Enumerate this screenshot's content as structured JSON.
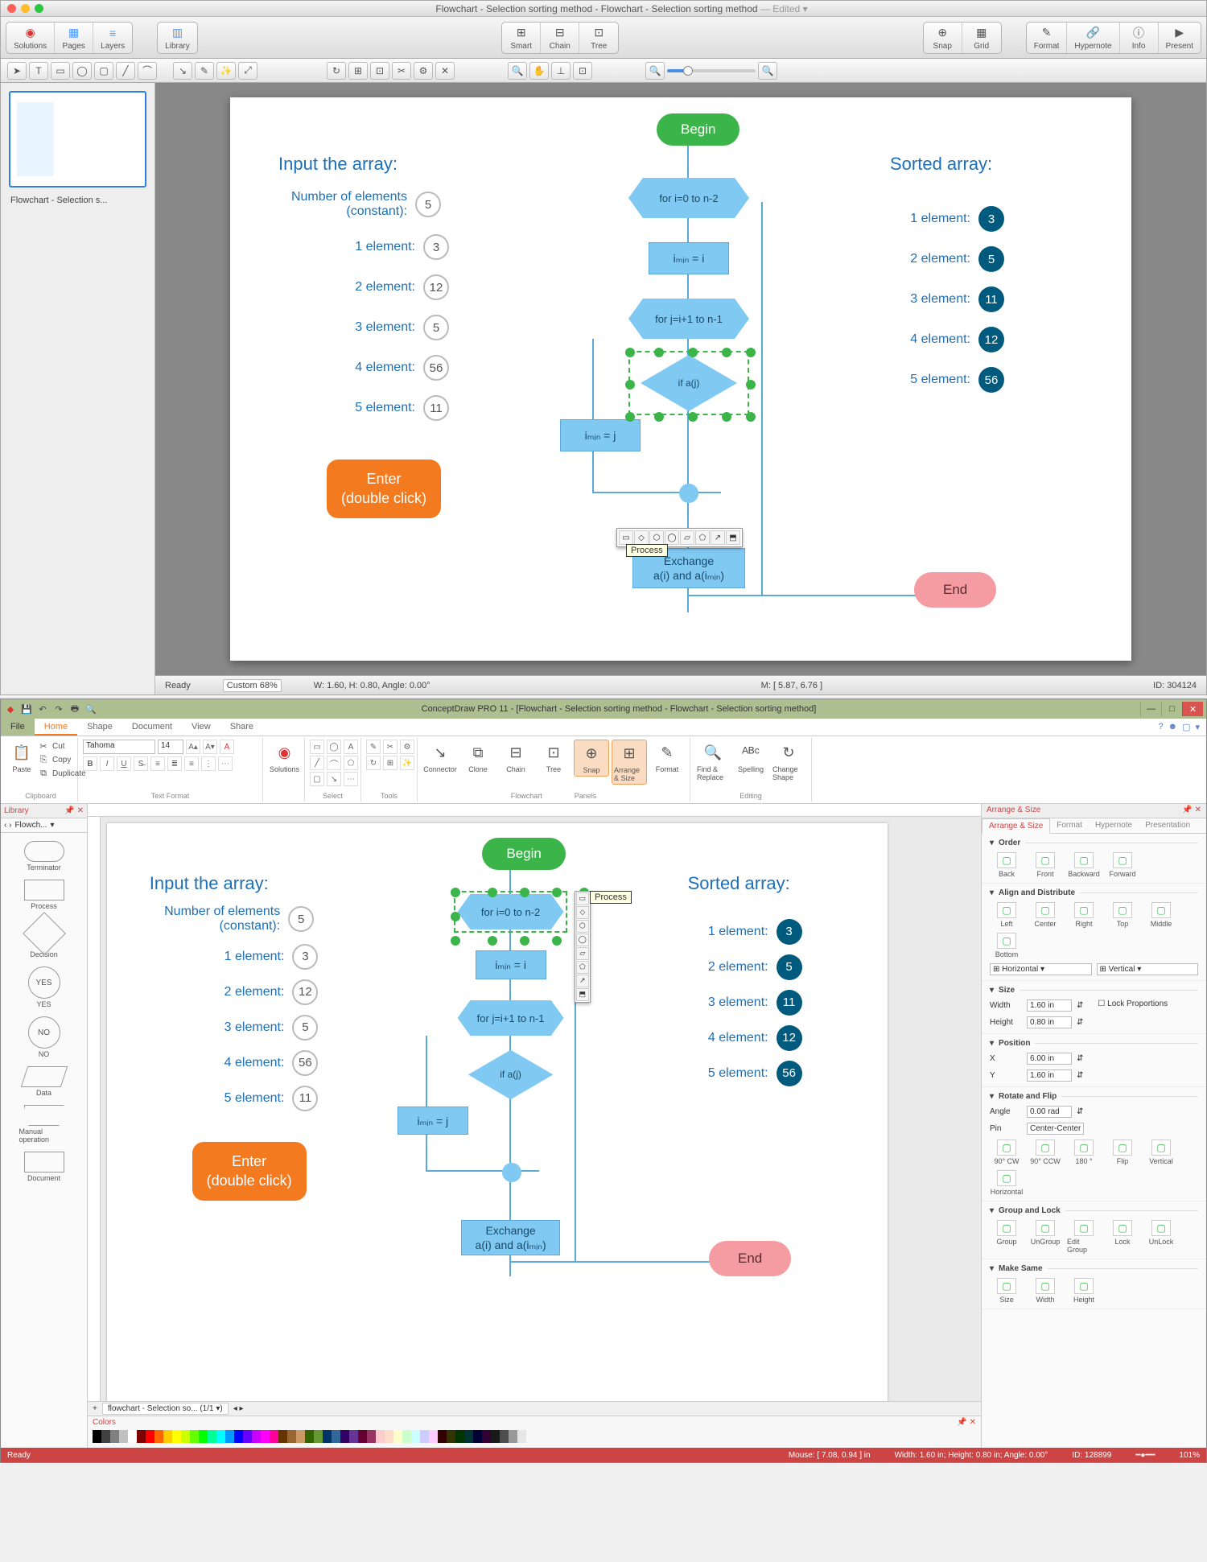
{
  "mac": {
    "title_a": "Flowchart - Selection sorting method - Flowchart - Selection sorting method",
    "title_edited": " — Edited ▾",
    "toolbar": {
      "left": [
        "Solutions",
        "Pages",
        "Layers"
      ],
      "library": "Library",
      "center": [
        "Smart",
        "Chain",
        "Tree"
      ],
      "snap": [
        "Snap",
        "Grid"
      ],
      "right": [
        "Format",
        "Hypernote",
        "Info",
        "Present"
      ]
    },
    "thumb_caption": "Flowchart - Selection s...",
    "zoom_label": "Custom 68%",
    "status_ready": "Ready",
    "status_wh": "W: 1.60, H: 0.80, Angle: 0.00°",
    "status_m": "M: [ 5.87, 6.76 ]",
    "status_id": "ID: 304124",
    "tooltip": "Process"
  },
  "win": {
    "title": "ConceptDraw PRO 11 - [Flowchart - Selection sorting method - Flowchart - Selection sorting method]",
    "tabs": {
      "file": "File",
      "home": "Home",
      "shape": "Shape",
      "document": "Document",
      "view": "View",
      "share": "Share"
    },
    "clipboard": {
      "paste": "Paste",
      "cut": "Cut",
      "copy": "Copy",
      "dup": "Duplicate",
      "label": "Clipboard"
    },
    "textformat": {
      "font": "Tahoma",
      "size": "14",
      "label": "Text Format"
    },
    "solutions": {
      "label": "Solutions"
    },
    "select_label": "Select",
    "tools_label": "Tools",
    "flow_group": [
      "Connector",
      "Clone",
      "Chain",
      "Tree",
      "Snap",
      "Arrange & Size",
      "Format"
    ],
    "flow_label": "Flowchart",
    "panels_label": "Panels",
    "edit_group": [
      "Find & Replace",
      "Spelling",
      "Change Shape"
    ],
    "edit_label": "Editing",
    "library": {
      "head": "Library",
      "combo": "Flowch...",
      "shapes": [
        {
          "name": "Terminator",
          "cls": "lib-sh-term"
        },
        {
          "name": "Process",
          "cls": ""
        },
        {
          "name": "Decision",
          "cls": "lib-sh-dec"
        },
        {
          "name": "YES",
          "cls": "lib-sh-yn",
          "txt": "YES"
        },
        {
          "name": "NO",
          "cls": "lib-sh-yn",
          "txt": "NO"
        },
        {
          "name": "Data",
          "cls": "lib-sh-data"
        },
        {
          "name": "Manual operation",
          "cls": "lib-sh-man"
        },
        {
          "name": "Document",
          "cls": ""
        }
      ]
    },
    "sheet_tab": "flowchart - Selection so...  (1/1  ▾)",
    "colors_head": "Colors",
    "tooltip": "Process",
    "arrange": {
      "head": "Arrange & Size",
      "tabs": [
        "Arrange & Size",
        "Format",
        "Hypernote",
        "Presentation"
      ],
      "order": {
        "h": "Order",
        "btns": [
          "Back",
          "Front",
          "Backward",
          "Forward"
        ]
      },
      "align": {
        "h": "Align and Distribute",
        "btns": [
          "Left",
          "Center",
          "Right",
          "Top",
          "Middle",
          "Bottom"
        ],
        "horiz": "Horizontal",
        "vert": "Vertical"
      },
      "size": {
        "h": "Size",
        "w_label": "Width",
        "w": "1.60 in",
        "h_label": "Height",
        "hv": "0.80 in",
        "lock": "Lock Proportions"
      },
      "pos": {
        "h": "Position",
        "x_label": "X",
        "x": "6.00 in",
        "y_label": "Y",
        "y": "1.60 in"
      },
      "rot": {
        "h": "Rotate and Flip",
        "a_label": "Angle",
        "a": "0.00 rad",
        "pin_label": "Pin",
        "pin": "Center-Center",
        "btns": [
          "90° CW",
          "90° CCW",
          "180 °",
          "Flip",
          "Vertical",
          "Horizontal"
        ]
      },
      "grp": {
        "h": "Group and Lock",
        "btns": [
          "Group",
          "UnGroup",
          "Edit Group",
          "Lock",
          "UnLock"
        ]
      },
      "same": {
        "h": "Make Same",
        "btns": [
          "Size",
          "Width",
          "Height"
        ]
      }
    },
    "status": {
      "ready": "Ready",
      "mouse": "Mouse: [ 7.08, 0.94 ] in",
      "dim": "Width: 1.60 in;  Height: 0.80 in;  Angle: 0.00°",
      "id": "ID: 128899",
      "zoom": "101%"
    }
  },
  "canvas": {
    "input_title": "Input the array:",
    "sorted_title": "Sorted array:",
    "num_elem_label_1": "Number of elements",
    "num_elem_label_2": "(constant):",
    "num_elem_val": "5",
    "inputs": [
      {
        "label": "1 element:",
        "val": "3"
      },
      {
        "label": "2 element:",
        "val": "12"
      },
      {
        "label": "3 element:",
        "val": "5"
      },
      {
        "label": "4 element:",
        "val": "56"
      },
      {
        "label": "5 element:",
        "val": "11"
      }
    ],
    "sorted": [
      {
        "label": "1 element:",
        "val": "3"
      },
      {
        "label": "2 element:",
        "val": "5"
      },
      {
        "label": "3 element:",
        "val": "11"
      },
      {
        "label": "4 element:",
        "val": "12"
      },
      {
        "label": "5 element:",
        "val": "56"
      }
    ],
    "enter_1": "Enter",
    "enter_2": "(double click)",
    "begin": "Begin",
    "end": "End",
    "hex1": "for i=0 to n-2",
    "box1": "iₘᵢₙ = i",
    "hex2": "for j=i+1 to n-1",
    "diamond": "if a(j)<a(iₘᵢₙ)",
    "box2": "iₘᵢₙ = j",
    "box3_a": "Exchange",
    "box3_b": "a(i) and a(iₘᵢₙ)"
  },
  "palette": [
    "#000000",
    "#404040",
    "#808080",
    "#c0c0c0",
    "#ffffff",
    "#800000",
    "#ff0000",
    "#ff6600",
    "#ffcc00",
    "#ffff00",
    "#ccff00",
    "#66ff00",
    "#00ff00",
    "#00ff99",
    "#00ffff",
    "#0099ff",
    "#0000ff",
    "#6600ff",
    "#cc00ff",
    "#ff00ff",
    "#ff0099",
    "#663300",
    "#996633",
    "#cc9966",
    "#336600",
    "#669933",
    "#003366",
    "#336699",
    "#330066",
    "#663399",
    "#660033",
    "#993366",
    "#ffcccc",
    "#ffddcc",
    "#ffffcc",
    "#ccffcc",
    "#ccffff",
    "#ccccff",
    "#ffccff",
    "#330000",
    "#333300",
    "#003300",
    "#003333",
    "#000033",
    "#330033",
    "#1a1a1a",
    "#4d4d4d",
    "#999999",
    "#e6e6e6"
  ]
}
